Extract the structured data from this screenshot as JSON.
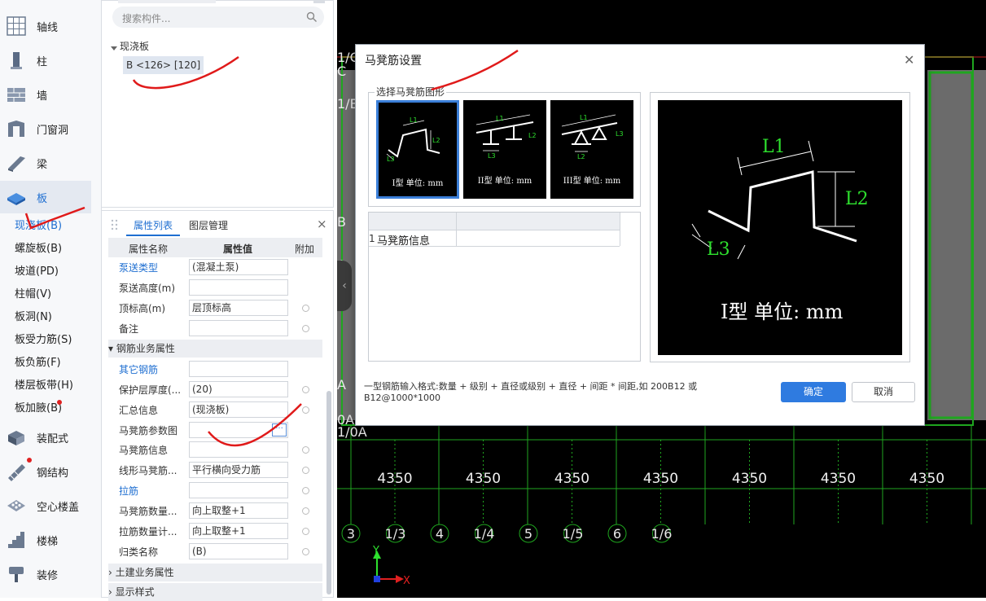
{
  "nav": {
    "items": [
      {
        "label": "轴线",
        "icon": "grid-axis-icon"
      },
      {
        "label": "柱",
        "icon": "column-icon"
      },
      {
        "label": "墙",
        "icon": "wall-icon"
      },
      {
        "label": "门窗洞",
        "icon": "door-window-icon"
      },
      {
        "label": "梁",
        "icon": "beam-icon"
      },
      {
        "label": "板",
        "icon": "slab-icon"
      }
    ],
    "sub_items": [
      "现浇板(B)",
      "螺旋板(B)",
      "坡道(PD)",
      "柱帽(V)",
      "板洞(N)",
      "板受力筋(S)",
      "板负筋(F)",
      "楼层板带(H)",
      "板加腋(B)"
    ],
    "items2": [
      {
        "label": "装配式",
        "icon": "prefab-icon"
      },
      {
        "label": "钢结构",
        "icon": "steel-structure-icon"
      },
      {
        "label": "空心楼盖",
        "icon": "hollow-floor-icon"
      },
      {
        "label": "楼梯",
        "icon": "stair-icon"
      },
      {
        "label": "装修",
        "icon": "decoration-icon"
      }
    ]
  },
  "tree": {
    "search_placeholder": "搜索构件...",
    "root": "现浇板",
    "item": "B <126> [120]"
  },
  "props": {
    "tab_active": "属性列表",
    "tab_other": "图层管理",
    "close": "×",
    "headers": [
      "属性名称",
      "属性值",
      "附加"
    ],
    "rows1": [
      {
        "name": "泵送类型",
        "value": "(混凝土泵)",
        "link": true,
        "dot": false
      },
      {
        "name": "泵送高度(m)",
        "value": "",
        "link": false,
        "dot": false
      },
      {
        "name": "顶标高(m)",
        "value": "层顶标高",
        "link": false,
        "dot": true
      },
      {
        "name": "备注",
        "value": "",
        "link": false,
        "dot": true
      }
    ],
    "group1": "钢筋业务属性",
    "rows2": [
      {
        "name": "其它钢筋",
        "value": "",
        "link": true,
        "dot": false
      },
      {
        "name": "保护层厚度(...",
        "value": "(20)",
        "link": false,
        "dot": true
      },
      {
        "name": "汇总信息",
        "value": "(现浇板)",
        "link": false,
        "dot": true
      },
      {
        "name": "马凳筋参数图",
        "value": "",
        "link": false,
        "dot": false,
        "ellipsis": "···"
      },
      {
        "name": "马凳筋信息",
        "value": "",
        "link": false,
        "dot": true
      },
      {
        "name": "线形马凳筋...",
        "value": "平行横向受力筋",
        "link": false,
        "dot": true
      },
      {
        "name": "拉筋",
        "value": "",
        "link": true,
        "dot": true
      },
      {
        "name": "马凳筋数量...",
        "value": "向上取整+1",
        "link": false,
        "dot": true
      },
      {
        "name": "拉筋数量计...",
        "value": "向上取整+1",
        "link": false,
        "dot": true
      },
      {
        "name": "归类名称",
        "value": "(B)",
        "link": false,
        "dot": true
      }
    ],
    "group2": "土建业务属性",
    "group3": "显示样式"
  },
  "cad": {
    "axis_labels_left": [
      "1/C",
      "C",
      "1/B",
      "B",
      "A",
      "A",
      "0A",
      "1/0A"
    ],
    "dims": [
      "4350",
      "4350",
      "4350",
      "4350",
      "4350",
      "4350",
      "4350"
    ],
    "bottom_axes": [
      "3",
      "1/3",
      "4",
      "1/4",
      "5",
      "1/5",
      "6",
      "1/6"
    ],
    "ucs_x": "X",
    "ucs_y": "Y",
    "collapse": "‹"
  },
  "dialog": {
    "title": "马凳筋设置",
    "close": "✕",
    "shape_group_label": "选择马凳筋图形",
    "shapes": [
      {
        "caption": "I型 单位: mm",
        "selected": true
      },
      {
        "caption": "II型 单位: mm",
        "selected": false
      },
      {
        "caption": "III型 单位: mm",
        "selected": false
      }
    ],
    "shape_labels": {
      "l1": "L1",
      "l2": "L2",
      "l3": "L3"
    },
    "table": {
      "row_index": "1",
      "row_label": "马凳筋信息",
      "row_value": ""
    },
    "preview_caption": "I型 单位: mm",
    "hint": "一型钢筋输入格式:数量 + 级别 + 直径或级别 + 直径 + 间距 * 间距,如 200B12 或 B12@1000*1000",
    "ok": "确定",
    "cancel": "取消"
  },
  "colors": {
    "accent": "#1f6fd1",
    "primary_button": "#2f7be0",
    "cad_green": "#1fa61f",
    "annotation_red": "#e01a1a",
    "dimension_green": "#2ee02e"
  }
}
